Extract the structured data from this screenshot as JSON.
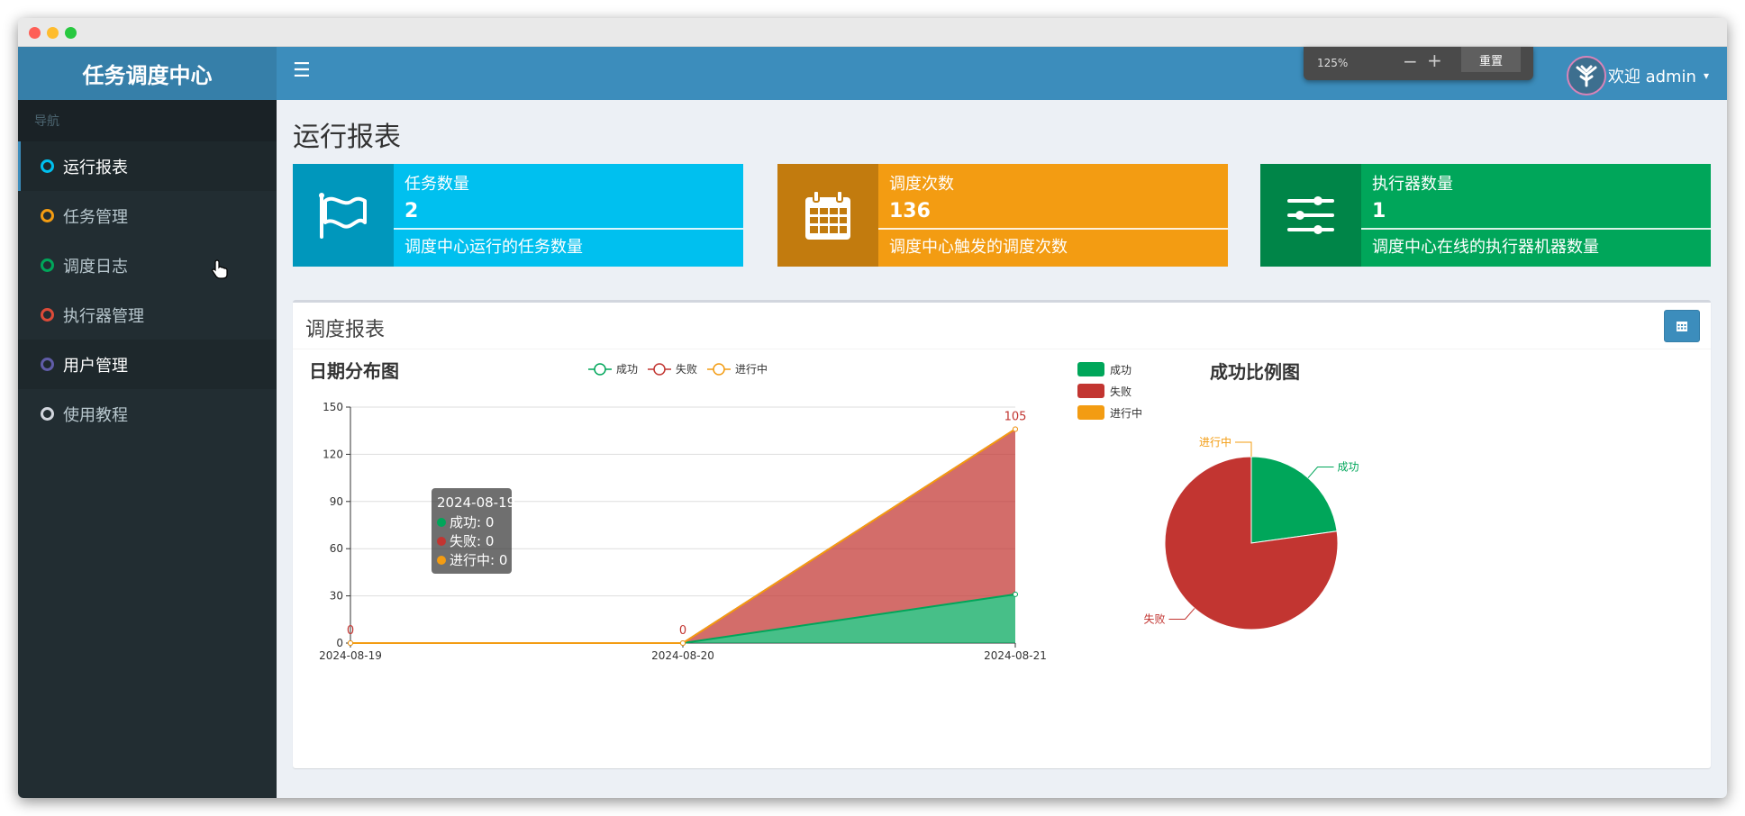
{
  "window": {
    "title": ""
  },
  "sidebar": {
    "brand": "任务调度中心",
    "header": "导航",
    "items": [
      {
        "label": "运行报表",
        "color": "#00c0ef"
      },
      {
        "label": "任务管理",
        "color": "#f39c12"
      },
      {
        "label": "调度日志",
        "color": "#00a65a"
      },
      {
        "label": "执行器管理",
        "color": "#dd4b39"
      },
      {
        "label": "用户管理",
        "color": "#605ca8"
      },
      {
        "label": "使用教程",
        "color": "#d2d6de"
      }
    ]
  },
  "topbar": {
    "menu_icon": "hamburger-icon",
    "zoom": {
      "level": "125%",
      "minus": "−",
      "plus": "+",
      "reset": "重置"
    },
    "user": {
      "label": "欢迎 admin",
      "caret": "▾"
    }
  },
  "page": {
    "title": "运行报表"
  },
  "stats": [
    {
      "label": "任务数量",
      "number": "2",
      "desc": "调度中心运行的任务数量",
      "icon": "flag-icon",
      "icon_bg": "#0097bc",
      "bg": "#00c0ef"
    },
    {
      "label": "调度次数",
      "number": "136",
      "desc": "调度中心触发的调度次数",
      "icon": "calendar-icon",
      "icon_bg": "#c27b0e",
      "bg": "#f39c12"
    },
    {
      "label": "执行器数量",
      "number": "1",
      "desc": "调度中心在线的执行器机器数量",
      "icon": "sliders-icon",
      "icon_bg": "#008548",
      "bg": "#00a65a"
    }
  ],
  "report": {
    "title": "调度报表",
    "date_button_icon": "calendar-icon"
  },
  "chart_data": [
    {
      "type": "area",
      "title": "日期分布图",
      "stacked": true,
      "categories": [
        "2024-08-19",
        "2024-08-20",
        "2024-08-21"
      ],
      "ylim": [
        0,
        150
      ],
      "yticks": [
        0,
        30,
        60,
        90,
        120,
        150
      ],
      "legend": "top",
      "series": [
        {
          "name": "成功",
          "values": [
            0,
            0,
            31
          ],
          "color": "#00a65a"
        },
        {
          "name": "失败",
          "values": [
            0,
            0,
            105
          ],
          "color": "#c23531"
        },
        {
          "name": "进行中",
          "values": [
            0,
            0,
            0
          ],
          "color": "#f39c12"
        }
      ],
      "data_labels": [
        {
          "category": "2024-08-19",
          "text": "0"
        },
        {
          "category": "2024-08-20",
          "text": "0"
        },
        {
          "category": "2024-08-21",
          "text": "105"
        }
      ],
      "tooltip": {
        "title": "2024-08-19",
        "rows": [
          "成功: 0",
          "失败: 0",
          "进行中: 0"
        ]
      }
    },
    {
      "type": "pie",
      "title": "成功比例图",
      "legend": "top-left",
      "series": [
        {
          "name": "成功",
          "value": 31,
          "color": "#00a65a"
        },
        {
          "name": "失败",
          "value": 105,
          "color": "#c23531"
        },
        {
          "name": "进行中",
          "value": 0,
          "color": "#f39c12"
        }
      ]
    }
  ]
}
